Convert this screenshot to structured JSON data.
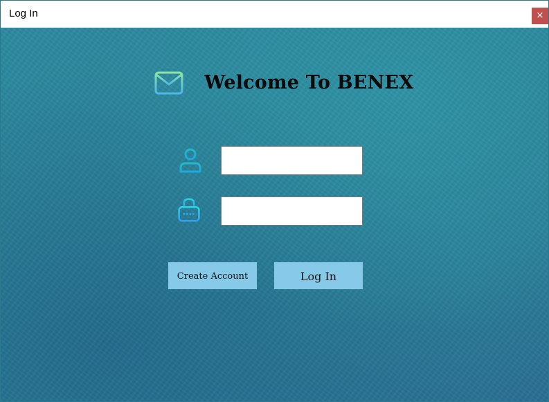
{
  "window": {
    "title": "Log In",
    "close_glyph": "×"
  },
  "header": {
    "icon": "envelope-icon",
    "title": "Welcome To BENEX"
  },
  "form": {
    "username": {
      "icon": "user-icon",
      "value": "",
      "placeholder": ""
    },
    "password": {
      "icon": "lock-icon",
      "value": "",
      "placeholder": ""
    }
  },
  "buttons": {
    "create_account": "Create Account",
    "log_in": "Log In"
  },
  "colors": {
    "background_teal": "#2a8399",
    "button_fill": "#87c9e8",
    "close_button": "#c0504d",
    "icon_cyan": "#1fc0e0"
  }
}
